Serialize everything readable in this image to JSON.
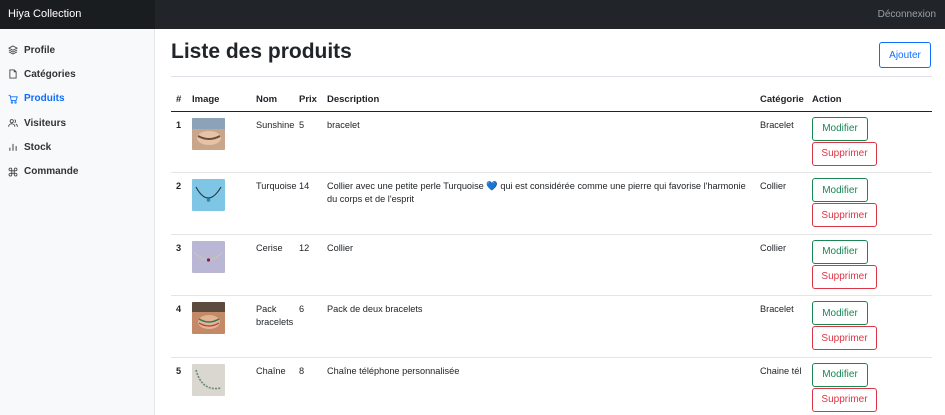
{
  "app": {
    "brand": "Hiya Collection",
    "logout": "Déconnexion"
  },
  "sidebar": {
    "items": [
      {
        "label": "Profile",
        "icon": "layers-icon"
      },
      {
        "label": "Catégories",
        "icon": "file-icon"
      },
      {
        "label": "Produits",
        "icon": "cart-icon"
      },
      {
        "label": "Visiteurs",
        "icon": "users-icon"
      },
      {
        "label": "Stock",
        "icon": "bar-chart-icon"
      },
      {
        "label": "Commande",
        "icon": "command-icon"
      }
    ]
  },
  "main": {
    "title": "Liste des produits",
    "add_button": "Ajouter"
  },
  "table": {
    "headers": {
      "num": "#",
      "image": "Image",
      "name": "Nom",
      "price": "Prix",
      "description": "Description",
      "category": "Catégorie",
      "action": "Action"
    },
    "rows": [
      {
        "num": "1",
        "name": "Sunshine",
        "price": "5",
        "description": "bracelet",
        "category": "Bracelet"
      },
      {
        "num": "2",
        "name": "Turquoise",
        "price": "14",
        "description": "Collier avec une petite perle Turquoise 💙 qui est considérée comme une pierre qui favorise l'harmonie du corps et de l'esprit",
        "category": "Collier"
      },
      {
        "num": "3",
        "name": "Cerise",
        "price": "12",
        "description": "Collier",
        "category": "Collier"
      },
      {
        "num": "4",
        "name": "Pack bracelets",
        "price": "6",
        "description": "Pack de deux bracelets",
        "category": "Bracelet"
      },
      {
        "num": "5",
        "name": "Chaîne",
        "price": "8",
        "description": "Chaîne téléphone personnalisée",
        "category": "Chaine tél"
      }
    ],
    "edit_label": "Modifier",
    "delete_label": "Supprimer"
  },
  "colors": {
    "primary": "#0d6efd",
    "success": "#198754",
    "danger": "#dc3545",
    "navbar": "#212529"
  }
}
